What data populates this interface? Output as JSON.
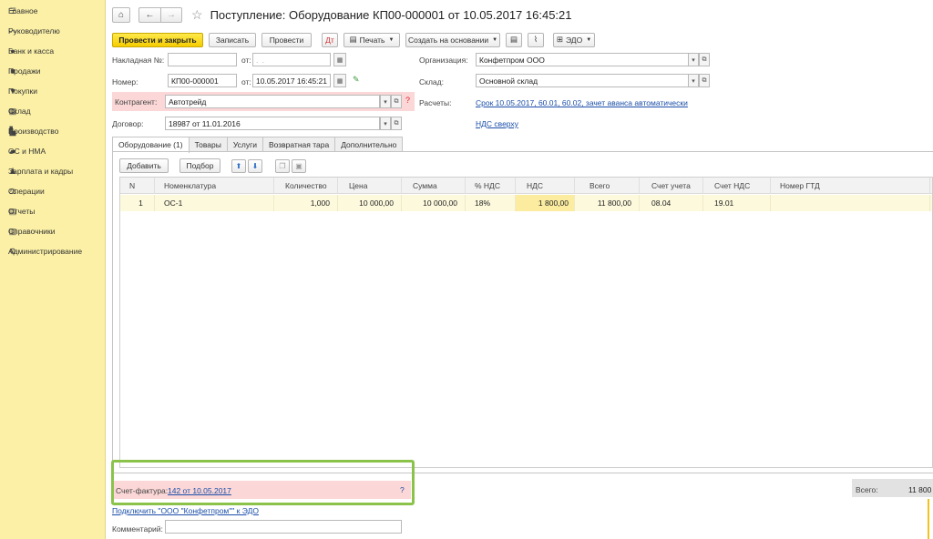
{
  "sidebar": {
    "items": [
      {
        "label": "Главное",
        "icon": "menu-icon"
      },
      {
        "label": "Руководителю",
        "icon": "chart-trend-icon"
      },
      {
        "label": "Банк и касса",
        "icon": "coin-icon"
      },
      {
        "label": "Продажи",
        "icon": "bag-icon"
      },
      {
        "label": "Покупки",
        "icon": "cart-icon"
      },
      {
        "label": "Склад",
        "icon": "warehouse-icon"
      },
      {
        "label": "Производство",
        "icon": "factory-icon"
      },
      {
        "label": "ОС и НМА",
        "icon": "truck-icon"
      },
      {
        "label": "Зарплата и кадры",
        "icon": "person-icon"
      },
      {
        "label": "Операции",
        "icon": "operations-icon"
      },
      {
        "label": "Отчеты",
        "icon": "report-icon"
      },
      {
        "label": "Справочники",
        "icon": "book-icon"
      },
      {
        "label": "Администрирование",
        "icon": "gear-icon"
      }
    ]
  },
  "window": {
    "title": "Поступление: Оборудование КП00-000001 от 10.05.2017 16:45:21"
  },
  "toolbar": {
    "post_close": "Провести и закрыть",
    "save": "Записать",
    "post": "Провести",
    "print": "Печать",
    "create_based": "Создать на основании",
    "edo": "ЭДО"
  },
  "form": {
    "invoice_label": "Накладная №:",
    "invoice_number": "",
    "from_label": "от:",
    "invoice_date_placeholder": ". .",
    "number_label": "Номер:",
    "number_value": "КП00-000001",
    "date_value": "10.05.2017 16:45:21",
    "organization_label": "Организация:",
    "organization_value": "Конфетпром ООО",
    "warehouse_label": "Склад:",
    "warehouse_value": "Основной склад",
    "counterparty_label": "Контрагент:",
    "counterparty_value": "Автотрейд",
    "settlements_label": "Расчеты:",
    "settlements_link": "Срок 10.05.2017, 60.01, 60.02, зачет аванса автоматически",
    "contract_label": "Договор:",
    "contract_value": "18987 от 11.01.2016",
    "vat_link": "НДС сверху"
  },
  "tabs": [
    {
      "label": "Оборудование (1)",
      "active": true
    },
    {
      "label": "Товары",
      "active": false
    },
    {
      "label": "Услуги",
      "active": false
    },
    {
      "label": "Возвратная тара",
      "active": false
    },
    {
      "label": "Дополнительно",
      "active": false
    }
  ],
  "table_toolbar": {
    "add": "Добавить",
    "pick": "Подбор"
  },
  "table": {
    "columns": [
      "N",
      "Номенклатура",
      "Количество",
      "Цена",
      "Сумма",
      "% НДС",
      "НДС",
      "Всего",
      "Счет учета",
      "Счет НДС",
      "Номер ГТД"
    ],
    "rows": [
      [
        "1",
        "ОС-1",
        "1,000",
        "10 000,00",
        "10 000,00",
        "18%",
        "1 800,00",
        "11 800,00",
        "08.04",
        "19.01",
        ""
      ]
    ]
  },
  "footer": {
    "invoice_label": "Счет-фактура:",
    "invoice_link": "142 от 10.05.2017",
    "question": "?",
    "connect_link": "Подключить \"ООО \"Конфетпром\"\" к ЭДО",
    "comment_label": "Комментарий:",
    "comment_value": "",
    "total_label": "Всего:",
    "total_value": "11 800"
  },
  "colors": {
    "sidebar_bg": "#fbf0a6",
    "primary_button": "#f5cd00",
    "highlight_frame": "#8bc34a",
    "error_bg": "#fbd7d7",
    "link": "#1a4ea8"
  }
}
